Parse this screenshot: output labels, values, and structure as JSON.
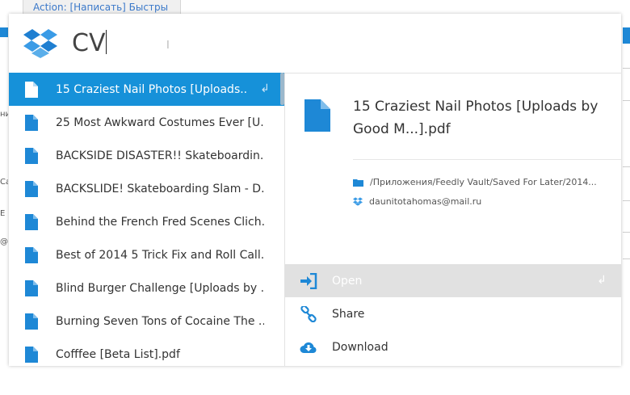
{
  "background": {
    "tab_label": "Action: [Написать] Быстры",
    "left_fragments": [
      "ни",
      "Са",
      "Е",
      "@"
    ]
  },
  "search": {
    "query": "CV"
  },
  "results": [
    {
      "label": "15 Craziest Nail Photos [Uploads...",
      "selected": true
    },
    {
      "label": "25 Most Awkward Costumes Ever [U..."
    },
    {
      "label": "BACKSIDE DISASTER!! Skateboardin..."
    },
    {
      "label": "BACKSLIDE! Skateboarding Slam - D..."
    },
    {
      "label": "Behind the French Fred Scenes Clich..."
    },
    {
      "label": "Best of 2014 5 Trick Fix and Roll Call..."
    },
    {
      "label": "Blind Burger Challenge [Uploads by ..."
    },
    {
      "label": "Burning Seven Tons of Cocaine The ..."
    },
    {
      "label": "Cofffee [Beta List].pdf"
    }
  ],
  "enter_symbol": "↲",
  "detail": {
    "title": "15 Craziest Nail Photos [Uploads by Good M...].pdf",
    "path": "/Приложения/Feedly Vault/Saved For Later/2014...",
    "account": "daunitotahomas@mail.ru"
  },
  "actions": [
    {
      "label": "Open",
      "icon": "sign-in-icon"
    },
    {
      "label": "Share",
      "icon": "link-icon"
    },
    {
      "label": "Download",
      "icon": "cloud-download-icon"
    }
  ],
  "colors": {
    "accent": "#1691d9",
    "icon_blue": "#1e88d6",
    "highlight": "#e1e1e1"
  }
}
